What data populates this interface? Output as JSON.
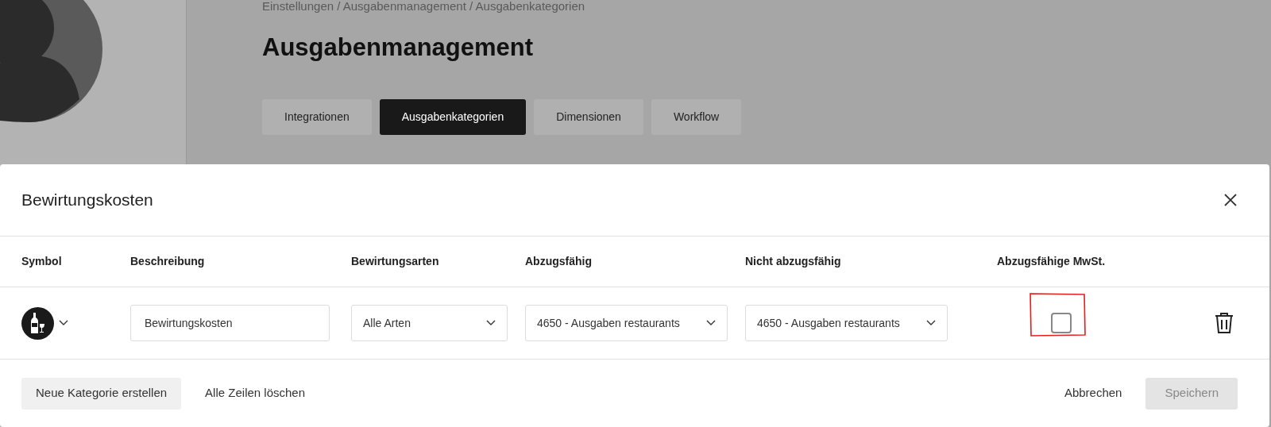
{
  "page": {
    "breadcrumb": "Einstellungen / Ausgabenmanagement / Ausgabenkategorien",
    "title": "Ausgabenmanagement",
    "tabs": [
      {
        "label": "Integrationen",
        "selected": false
      },
      {
        "label": "Ausgabenkategorien",
        "selected": true
      },
      {
        "label": "Dimensionen",
        "selected": false
      },
      {
        "label": "Workflow",
        "selected": false
      }
    ]
  },
  "dialog": {
    "title": "Bewirtungskosten",
    "columns": [
      "Symbol",
      "Beschreibung",
      "Bewirtungsarten",
      "Abzugsfähig",
      "Nicht abzugsfähig",
      "Abzugsfähige MwSt."
    ],
    "rows": [
      {
        "description": "Bewirtungskosten",
        "types": "Alle Arten",
        "deductible": "4650 - Ausgaben restaurants",
        "non_deductible": "4650 - Ausgaben restaurants",
        "vat_deductible": false,
        "annotated": true
      }
    ],
    "footer_left": [
      "Neue Kategorie erstellen",
      "Alle Zeilen löschen"
    ],
    "cancel": "Abbrechen",
    "save": {
      "label": "Speichern",
      "disabled": true
    }
  }
}
